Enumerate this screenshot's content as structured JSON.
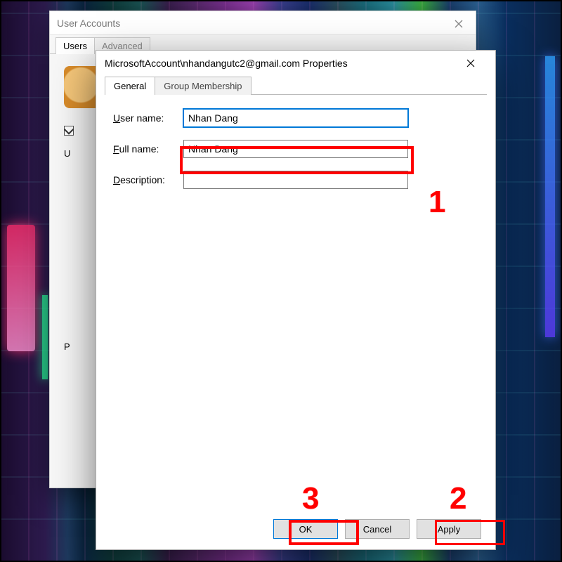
{
  "back_window": {
    "title": "User Accounts",
    "tabs": [
      "Users",
      "Advanced"
    ],
    "label_U": "U",
    "label_P": "P"
  },
  "front_window": {
    "title": "MicrosoftAccount\\nhandangutc2@gmail.com Properties",
    "tabs": {
      "general": "General",
      "group": "Group Membership"
    },
    "labels": {
      "username": "User name:",
      "fullname": "Full name:",
      "description": "Description:"
    },
    "fields": {
      "username": "Nhan Dang",
      "fullname": "Nhan Dang",
      "description": ""
    },
    "buttons": {
      "ok": "OK",
      "cancel": "Cancel",
      "apply": "Apply"
    }
  },
  "annotations": {
    "n1": "1",
    "n2": "2",
    "n3": "3"
  }
}
